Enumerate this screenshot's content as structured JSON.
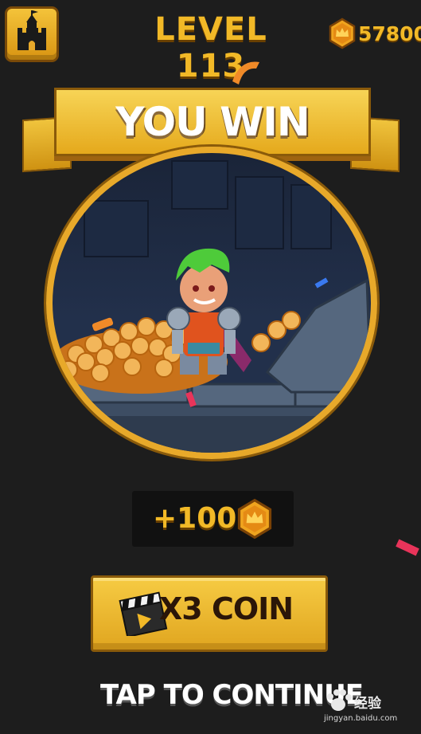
{
  "header": {
    "home_icon": "castle-icon",
    "level_label": "LEVEL 113",
    "coin_icon": "crown-coin-icon",
    "coin_balance": "57800"
  },
  "banner": {
    "title": "YOU WIN"
  },
  "scene": {
    "character": "green-haired knight",
    "description_icon": "treasure-pile"
  },
  "reward": {
    "amount_label": "+100",
    "icon": "crown-coin-icon"
  },
  "multiplier_button": {
    "label": "X3 COIN",
    "icon": "video-clapper-icon"
  },
  "continue_prompt": "TAP TO CONTINUE",
  "watermark": {
    "brand": "Bai",
    "brand_cn": "经验",
    "url": "jingyan.baidu.com"
  },
  "colors": {
    "background": "#1d1d1d",
    "gold": "#f2b927",
    "dark_outline": "#8a5a0a",
    "button_text": "#2b1608"
  }
}
